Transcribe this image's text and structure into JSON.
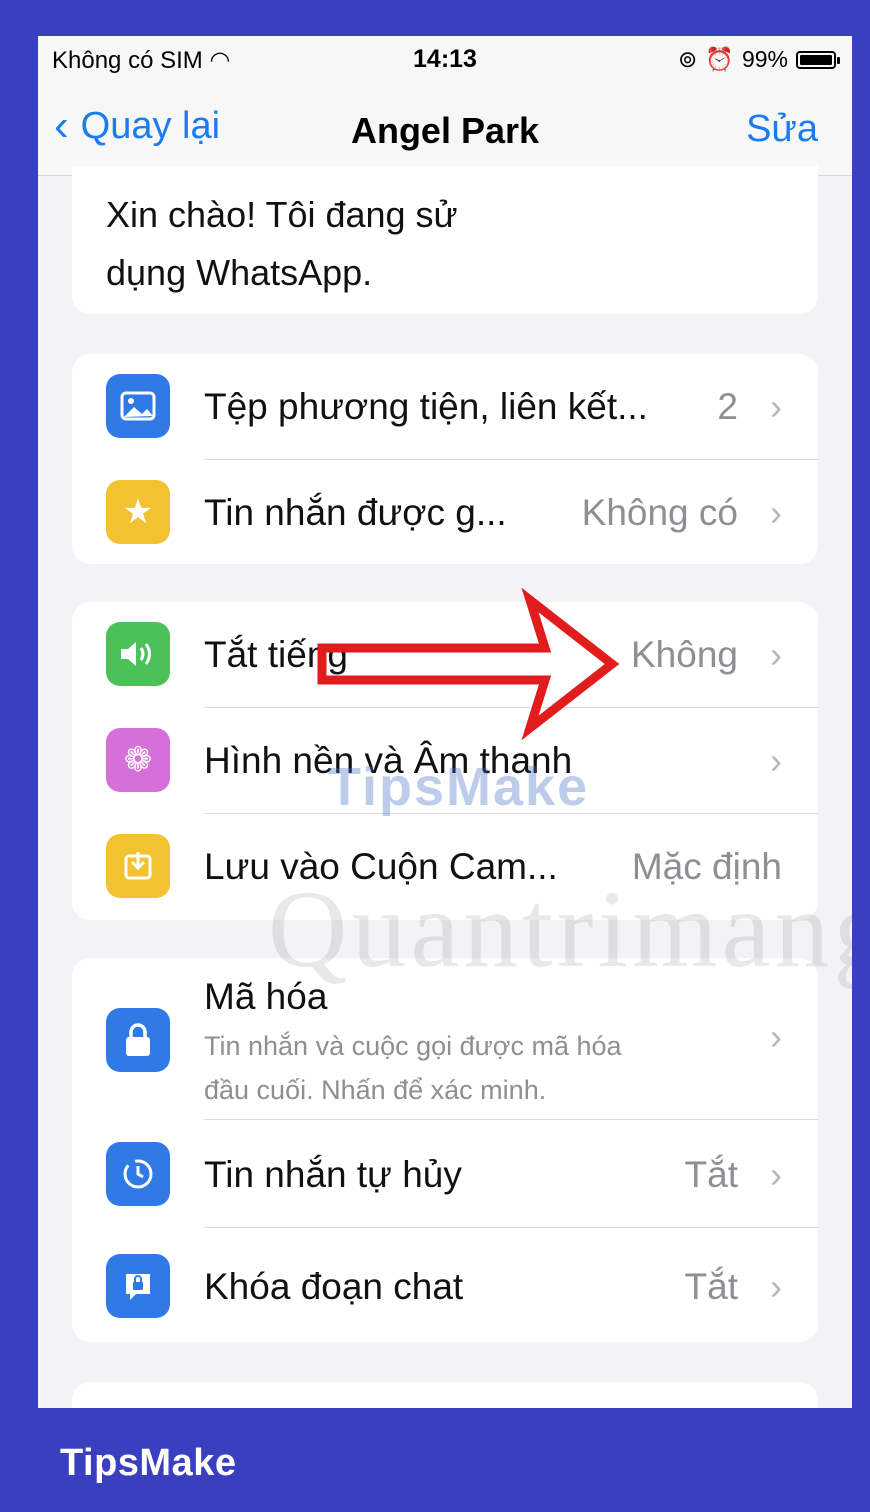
{
  "status_bar": {
    "carrier": "Không có SIM",
    "time": "14:13",
    "battery": "99%",
    "battery_level": 0.99
  },
  "nav": {
    "back_label": "Quay lại",
    "title": "Angel Park",
    "edit_label": "Sửa"
  },
  "about": {
    "line1": "Xin chào! Tôi đang sử",
    "line2": "dụng WhatsApp."
  },
  "group1": [
    {
      "label": "Tệp phương tiện, liên kết...",
      "value": "2",
      "icon": "photo-icon",
      "color": "#2f7ae5"
    },
    {
      "label": "Tin nhắn được g...",
      "value": "Không có",
      "icon": "star-icon",
      "color": "#f2c230"
    }
  ],
  "group2": [
    {
      "label": "Tắt tiếng",
      "value": "Không",
      "icon": "speaker-icon",
      "color": "#4cc15a"
    },
    {
      "label": "Hình nền và Âm thanh",
      "value": "",
      "icon": "flower-icon",
      "color": "#d66fd8"
    },
    {
      "label": "Lưu vào Cuộn Cam...",
      "value": "Mặc định",
      "icon": "save-icon",
      "color": "#f2c230"
    }
  ],
  "group3": [
    {
      "label": "Mã hóa",
      "sub1": "Tin nhắn và cuộc gọi được mã hóa",
      "sub2": "đầu cuối. Nhấn để xác minh.",
      "icon": "lock-icon",
      "color": "#2f7ae5"
    },
    {
      "label": "Tin nhắn tự hủy",
      "value": "Tắt",
      "icon": "timer-icon",
      "color": "#2f7ae5"
    },
    {
      "label": "Khóa đoạn chat",
      "value": "Tắt",
      "icon": "chat-lock-icon",
      "color": "#2f7ae5"
    }
  ],
  "watermark": {
    "brand": "TipsMake",
    "site": "Quantrimang"
  },
  "footer": {
    "brand": "TipsMake"
  },
  "colors": {
    "accent": "#1a7cf0",
    "frame": "#3a3fbf",
    "arrow": "#e01c1c"
  }
}
